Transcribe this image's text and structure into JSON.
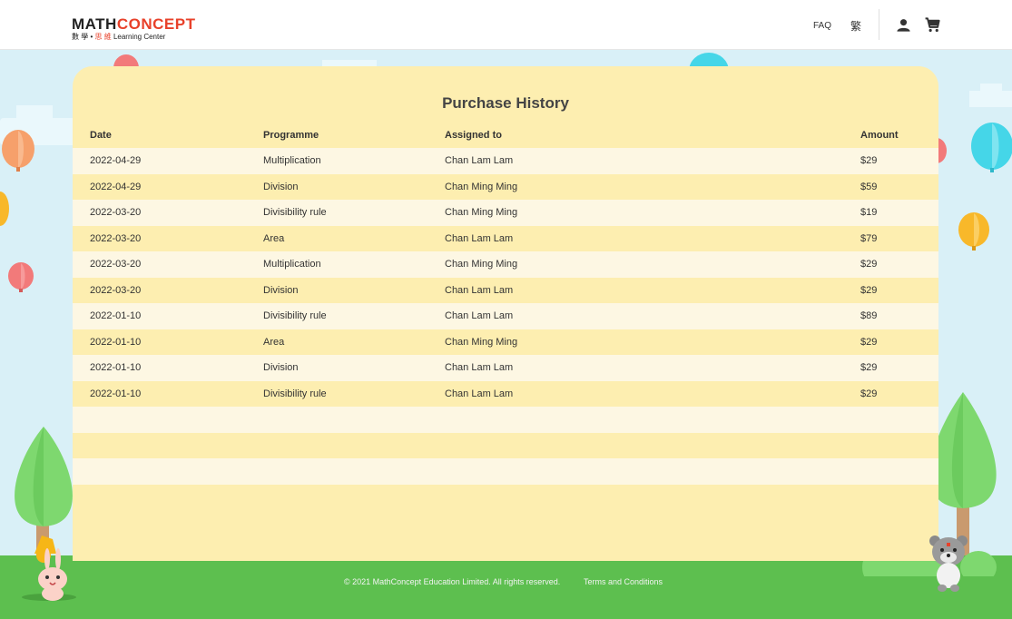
{
  "header": {
    "logo_main_a": "MATH",
    "logo_main_b": "CONCEPT",
    "logo_sub_cn_a": "數 學 •",
    "logo_sub_cn_b": "思 維",
    "logo_sub_en": "Learning Center",
    "faq": "FAQ",
    "lang": "繁",
    "user_icon": "user-icon",
    "cart_icon": "cart-icon"
  },
  "page": {
    "title": "Purchase History"
  },
  "table": {
    "headers": [
      "Date",
      "Programme",
      "Assigned to",
      "Amount"
    ],
    "rows": [
      [
        "2022-04-29",
        "Multiplication",
        "Chan Lam Lam",
        "$29"
      ],
      [
        "2022-04-29",
        "Division",
        "Chan Ming Ming",
        "$59"
      ],
      [
        "2022-03-20",
        "Divisibility rule",
        "Chan Ming Ming",
        "$19"
      ],
      [
        "2022-03-20",
        "Area",
        "Chan Lam Lam",
        "$79"
      ],
      [
        "2022-03-20",
        "Multiplication",
        "Chan Ming Ming",
        "$29"
      ],
      [
        "2022-03-20",
        "Division",
        "Chan Lam Lam",
        "$29"
      ],
      [
        "2022-01-10",
        "Divisibility rule",
        "Chan Lam Lam",
        "$89"
      ],
      [
        "2022-01-10",
        "Area",
        "Chan Ming Ming",
        "$29"
      ],
      [
        "2022-01-10",
        "Division",
        "Chan Lam Lam",
        "$29"
      ],
      [
        "2022-01-10",
        "Divisibility rule",
        "Chan Lam Lam",
        "$29"
      ]
    ],
    "empty_rows": 3
  },
  "footer": {
    "copyright": "© 2021 MathConcept Education Limited. All rights reserved.",
    "terms": "Terms and Conditions"
  },
  "colors": {
    "card": "#fdeeb0",
    "row_light": "#fdf7e3",
    "ground": "#5dbf4f",
    "brand_red": "#e8412a"
  }
}
